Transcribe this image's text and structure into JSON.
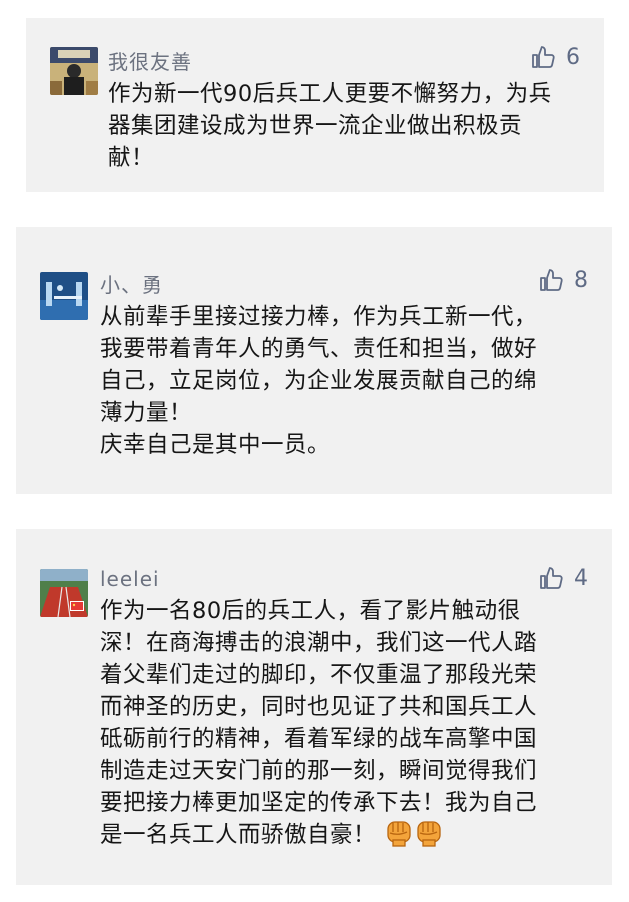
{
  "comments": [
    {
      "username": "我很友善",
      "likes": "6",
      "lines": [
        "作为新一代90后兵工人更要不懈努力，为兵",
        "器集团建设成为世界一流企业做出积极贡",
        "献！"
      ]
    },
    {
      "username": "小、勇",
      "likes": "8",
      "lines": [
        "从前辈手里接过接力棒，作为兵工新一代，",
        "我要带着青年人的勇气、责任和担当，做好",
        "自己，立足岗位，为企业发展贡献自己的绵",
        "薄力量！",
        "庆幸自己是其中一员。"
      ]
    },
    {
      "username": "leelei",
      "likes": "4",
      "lines": [
        "作为一名80后的兵工人，看了影片触动很",
        "深！在商海搏击的浪潮中，我们这一代人踏",
        "着父辈们走过的脚印，不仅重温了那段光荣",
        "而神圣的历史，同时也见证了共和国兵工人",
        "砥砺前行的精神，看着军绿的战车高擎中国",
        "制造走过天安门前的那一刻，瞬间觉得我们",
        "要把接力棒更加坚定的传承下去！我为自己",
        "是一名兵工人而骄傲自豪！"
      ],
      "emoji": [
        "fist-icon",
        "fist-icon"
      ]
    }
  ],
  "colors": {
    "card_bg": "#f1f1f1",
    "username": "#6c7280",
    "like": "#5f6b85",
    "text": "#161616"
  }
}
